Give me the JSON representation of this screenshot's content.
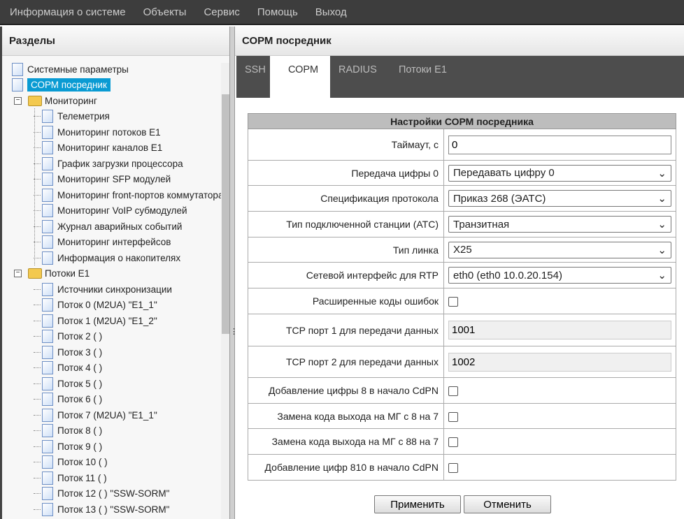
{
  "menu": [
    "Информация о системе",
    "Объекты",
    "Сервис",
    "Помощь",
    "Выход"
  ],
  "left": {
    "title": "Разделы",
    "top": [
      "Системные параметры",
      "СОРМ посредник"
    ],
    "monitoring": {
      "label": "Мониторинг",
      "items": [
        "Телеметрия",
        "Мониторинг потоков E1",
        "Мониторинг каналов E1",
        "График загрузки процессора",
        "Мониторинг SFP модулей",
        "Мониторинг front-портов коммутатора",
        "Мониторинг VoIP субмодулей",
        "Журнал аварийных событий",
        "Мониторинг интерфейсов",
        "Информация о накопителях"
      ]
    },
    "streams": {
      "label": "Потоки E1",
      "items": [
        "Источники синхронизации",
        "Поток 0 (M2UA) \"E1_1\"",
        "Поток 1 (M2UA) \"E1_2\"",
        "Поток 2 ( )",
        "Поток 3 ( )",
        "Поток 4 ( )",
        "Поток 5 ( )",
        "Поток 6 ( )",
        "Поток 7 (M2UA) \"E1_1\"",
        "Поток 8 ( )",
        "Поток 9 ( )",
        "Поток 10 ( )",
        "Поток 11 ( )",
        "Поток 12 ( ) \"SSW-SORM\"",
        "Поток 13 ( ) \"SSW-SORM\""
      ]
    }
  },
  "right": {
    "title": "СОРМ посредник",
    "tabs": [
      "SSH",
      "СОРМ",
      "RADIUS",
      "Потоки E1"
    ],
    "table_title": "Настройки СОРМ посредника",
    "rows": [
      {
        "label": "Таймаут, с",
        "type": "text",
        "value": "0"
      },
      {
        "label": "Передача цифры 0",
        "type": "select",
        "value": "Передавать цифру 0"
      },
      {
        "label": "Спецификация протокола",
        "type": "select",
        "value": "Приказ 268 (ЭАТС)"
      },
      {
        "label": "Тип подключенной станции (АТС)",
        "type": "select",
        "value": "Транзитная"
      },
      {
        "label": "Тип линка",
        "type": "select",
        "value": "X25"
      },
      {
        "label": "Сетевой интерфейс для RTP",
        "type": "select",
        "value": "eth0 (eth0 10.0.20.154)"
      },
      {
        "label": "Расширенные коды ошибок",
        "type": "check",
        "value": ""
      },
      {
        "label": "TCP порт 1 для передачи данных",
        "type": "ro",
        "value": "1001"
      },
      {
        "label": "TCP порт 2 для передачи данных",
        "type": "ro",
        "value": "1002"
      },
      {
        "label": "Добавление цифры 8 в начало CdPN",
        "type": "check",
        "value": ""
      },
      {
        "label": "Замена кода выхода на МГ с 8 на 7",
        "type": "check",
        "value": ""
      },
      {
        "label": "Замена кода выхода на МГ с 88 на 7",
        "type": "check",
        "value": ""
      },
      {
        "label": "Добавление цифр 810 в начало CdPN",
        "type": "check",
        "value": ""
      }
    ],
    "apply": "Применить",
    "cancel": "Отменить"
  }
}
